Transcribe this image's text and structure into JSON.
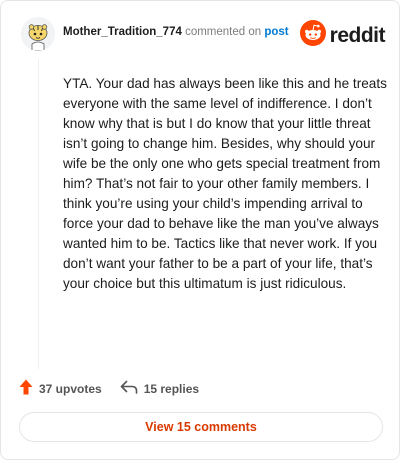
{
  "comment": {
    "author": "Mother_Tradition_774",
    "action_text": "commented on",
    "post_link": "post",
    "body": "YTA. Your dad has always been like this and he treats everyone with the same level of indifference. I don’t know why that is but I do know that your little threat isn’t going to change him. Besides, why should your wife be the only one who gets special treatment from him? That’s not fair to your other family members. I think you’re using your child’s impending arrival to force your dad to behave like the man you’ve always wanted him to be. Tactics like that never work. If you don’t want your father to be a part of your life, that’s your choice but this ultimatum is just ridiculous."
  },
  "brand": {
    "name": "reddit",
    "icon": "reddit-logo-icon",
    "color": "#ff4500"
  },
  "actions": {
    "upvotes": "37 upvotes",
    "upvote_icon": "upvote-arrow-icon",
    "upvote_color": "#ff4500",
    "replies": "15 replies",
    "reply_icon": "reply-arrow-icon"
  },
  "view_comments_label": "View 15 comments",
  "colors": {
    "accent": "#d93a00",
    "link": "#0079d3"
  }
}
